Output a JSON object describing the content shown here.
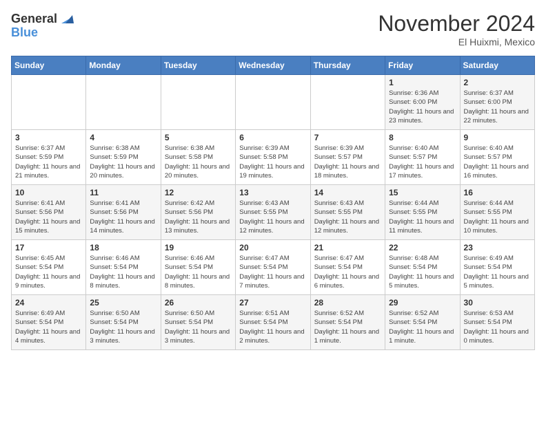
{
  "logo": {
    "general": "General",
    "blue": "Blue"
  },
  "title": "November 2024",
  "location": "El Huixmi, Mexico",
  "days_header": [
    "Sunday",
    "Monday",
    "Tuesday",
    "Wednesday",
    "Thursday",
    "Friday",
    "Saturday"
  ],
  "weeks": [
    [
      {
        "day": "",
        "info": ""
      },
      {
        "day": "",
        "info": ""
      },
      {
        "day": "",
        "info": ""
      },
      {
        "day": "",
        "info": ""
      },
      {
        "day": "",
        "info": ""
      },
      {
        "day": "1",
        "info": "Sunrise: 6:36 AM\nSunset: 6:00 PM\nDaylight: 11 hours and 23 minutes."
      },
      {
        "day": "2",
        "info": "Sunrise: 6:37 AM\nSunset: 6:00 PM\nDaylight: 11 hours and 22 minutes."
      }
    ],
    [
      {
        "day": "3",
        "info": "Sunrise: 6:37 AM\nSunset: 5:59 PM\nDaylight: 11 hours and 21 minutes."
      },
      {
        "day": "4",
        "info": "Sunrise: 6:38 AM\nSunset: 5:59 PM\nDaylight: 11 hours and 20 minutes."
      },
      {
        "day": "5",
        "info": "Sunrise: 6:38 AM\nSunset: 5:58 PM\nDaylight: 11 hours and 20 minutes."
      },
      {
        "day": "6",
        "info": "Sunrise: 6:39 AM\nSunset: 5:58 PM\nDaylight: 11 hours and 19 minutes."
      },
      {
        "day": "7",
        "info": "Sunrise: 6:39 AM\nSunset: 5:57 PM\nDaylight: 11 hours and 18 minutes."
      },
      {
        "day": "8",
        "info": "Sunrise: 6:40 AM\nSunset: 5:57 PM\nDaylight: 11 hours and 17 minutes."
      },
      {
        "day": "9",
        "info": "Sunrise: 6:40 AM\nSunset: 5:57 PM\nDaylight: 11 hours and 16 minutes."
      }
    ],
    [
      {
        "day": "10",
        "info": "Sunrise: 6:41 AM\nSunset: 5:56 PM\nDaylight: 11 hours and 15 minutes."
      },
      {
        "day": "11",
        "info": "Sunrise: 6:41 AM\nSunset: 5:56 PM\nDaylight: 11 hours and 14 minutes."
      },
      {
        "day": "12",
        "info": "Sunrise: 6:42 AM\nSunset: 5:56 PM\nDaylight: 11 hours and 13 minutes."
      },
      {
        "day": "13",
        "info": "Sunrise: 6:43 AM\nSunset: 5:55 PM\nDaylight: 11 hours and 12 minutes."
      },
      {
        "day": "14",
        "info": "Sunrise: 6:43 AM\nSunset: 5:55 PM\nDaylight: 11 hours and 12 minutes."
      },
      {
        "day": "15",
        "info": "Sunrise: 6:44 AM\nSunset: 5:55 PM\nDaylight: 11 hours and 11 minutes."
      },
      {
        "day": "16",
        "info": "Sunrise: 6:44 AM\nSunset: 5:55 PM\nDaylight: 11 hours and 10 minutes."
      }
    ],
    [
      {
        "day": "17",
        "info": "Sunrise: 6:45 AM\nSunset: 5:54 PM\nDaylight: 11 hours and 9 minutes."
      },
      {
        "day": "18",
        "info": "Sunrise: 6:46 AM\nSunset: 5:54 PM\nDaylight: 11 hours and 8 minutes."
      },
      {
        "day": "19",
        "info": "Sunrise: 6:46 AM\nSunset: 5:54 PM\nDaylight: 11 hours and 8 minutes."
      },
      {
        "day": "20",
        "info": "Sunrise: 6:47 AM\nSunset: 5:54 PM\nDaylight: 11 hours and 7 minutes."
      },
      {
        "day": "21",
        "info": "Sunrise: 6:47 AM\nSunset: 5:54 PM\nDaylight: 11 hours and 6 minutes."
      },
      {
        "day": "22",
        "info": "Sunrise: 6:48 AM\nSunset: 5:54 PM\nDaylight: 11 hours and 5 minutes."
      },
      {
        "day": "23",
        "info": "Sunrise: 6:49 AM\nSunset: 5:54 PM\nDaylight: 11 hours and 5 minutes."
      }
    ],
    [
      {
        "day": "24",
        "info": "Sunrise: 6:49 AM\nSunset: 5:54 PM\nDaylight: 11 hours and 4 minutes."
      },
      {
        "day": "25",
        "info": "Sunrise: 6:50 AM\nSunset: 5:54 PM\nDaylight: 11 hours and 3 minutes."
      },
      {
        "day": "26",
        "info": "Sunrise: 6:50 AM\nSunset: 5:54 PM\nDaylight: 11 hours and 3 minutes."
      },
      {
        "day": "27",
        "info": "Sunrise: 6:51 AM\nSunset: 5:54 PM\nDaylight: 11 hours and 2 minutes."
      },
      {
        "day": "28",
        "info": "Sunrise: 6:52 AM\nSunset: 5:54 PM\nDaylight: 11 hours and 1 minute."
      },
      {
        "day": "29",
        "info": "Sunrise: 6:52 AM\nSunset: 5:54 PM\nDaylight: 11 hours and 1 minute."
      },
      {
        "day": "30",
        "info": "Sunrise: 6:53 AM\nSunset: 5:54 PM\nDaylight: 11 hours and 0 minutes."
      }
    ]
  ]
}
